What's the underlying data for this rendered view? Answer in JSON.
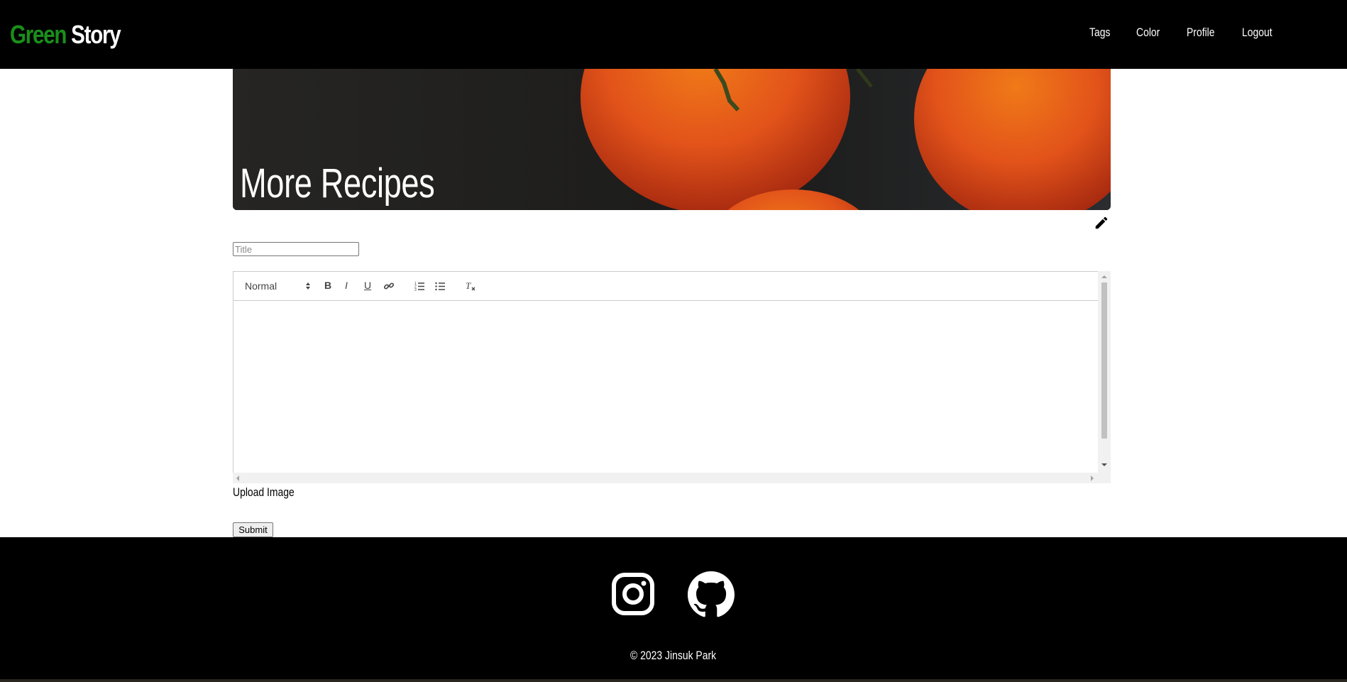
{
  "brand": {
    "first": "Green",
    "second": "Story"
  },
  "nav": {
    "tags": "Tags",
    "color": "Color",
    "profile": "Profile",
    "logout": "Logout"
  },
  "hero": {
    "title": "More Recipes"
  },
  "form": {
    "title_placeholder": "Title",
    "title_value": "",
    "toolbar": {
      "header_select": "Normal",
      "bold": "B",
      "italic": "I",
      "underline": "U"
    },
    "upload_label": "Upload Image",
    "submit_label": "Submit"
  },
  "footer": {
    "icons": [
      "instagram-icon",
      "github-icon"
    ],
    "copyright": "© 2023 Jinsuk Park"
  },
  "colors": {
    "brand_green": "#1a8f1a",
    "navbar_bg": "#000000",
    "footer_bg": "#000000"
  }
}
